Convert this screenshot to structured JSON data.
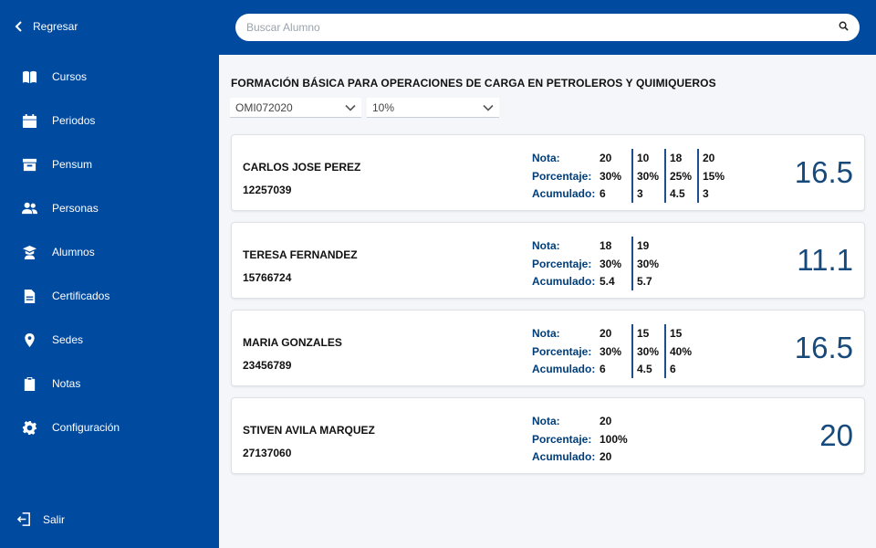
{
  "sidebar": {
    "back_label": "Regresar",
    "items": [
      {
        "label": "Cursos",
        "icon": "book-icon"
      },
      {
        "label": "Periodos",
        "icon": "calendar-icon"
      },
      {
        "label": "Pensum",
        "icon": "archive-icon"
      },
      {
        "label": "Personas",
        "icon": "users-icon"
      },
      {
        "label": "Alumnos",
        "icon": "graduation-icon"
      },
      {
        "label": "Certificados",
        "icon": "document-icon"
      },
      {
        "label": "Sedes",
        "icon": "location-pin-icon"
      },
      {
        "label": "Notas",
        "icon": "clipboard-icon"
      },
      {
        "label": "Configuración",
        "icon": "gear-icon"
      }
    ],
    "logout_label": "Salir"
  },
  "search": {
    "placeholder": "Buscar Alumno",
    "value": ""
  },
  "course": {
    "title": "FORMACIÓN BÁSICA PARA OPERACIONES DE CARGA EN PETROLEROS Y QUIMIQUEROS",
    "code_select": "OMI072020",
    "percent_select": "10%"
  },
  "row_labels": {
    "nota": "Nota:",
    "porcentaje": "Porcentaje:",
    "acumulado": "Acumulado:"
  },
  "students": [
    {
      "name": "CARLOS JOSE PEREZ",
      "id": "12257039",
      "total": "16.5",
      "grades": [
        {
          "nota": "20",
          "porcentaje": "30%",
          "acumulado": "6"
        },
        {
          "nota": "10",
          "porcentaje": "30%",
          "acumulado": "3"
        },
        {
          "nota": "18",
          "porcentaje": "25%",
          "acumulado": "4.5"
        },
        {
          "nota": "20",
          "porcentaje": "15%",
          "acumulado": "3"
        }
      ]
    },
    {
      "name": "TERESA FERNANDEZ",
      "id": "15766724",
      "total": "11.1",
      "grades": [
        {
          "nota": "18",
          "porcentaje": "30%",
          "acumulado": "5.4"
        },
        {
          "nota": "19",
          "porcentaje": "30%",
          "acumulado": "5.7"
        }
      ]
    },
    {
      "name": "MARIA GONZALES",
      "id": "23456789",
      "total": "16.5",
      "grades": [
        {
          "nota": "20",
          "porcentaje": "30%",
          "acumulado": "6"
        },
        {
          "nota": "15",
          "porcentaje": "30%",
          "acumulado": "4.5"
        },
        {
          "nota": "15",
          "porcentaje": "40%",
          "acumulado": "6"
        }
      ]
    },
    {
      "name": "STIVEN AVILA MARQUEZ",
      "id": "27137060",
      "total": "20",
      "grades": [
        {
          "nota": "20",
          "porcentaje": "100%",
          "acumulado": "20"
        }
      ]
    }
  ]
}
